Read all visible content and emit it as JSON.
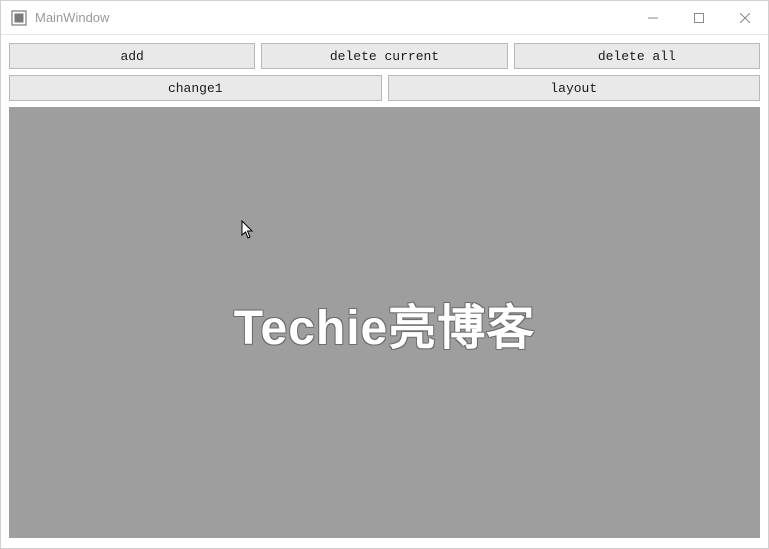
{
  "window": {
    "title": "MainWindow"
  },
  "toolbar": {
    "row1": {
      "add_label": "add",
      "delete_current_label": "delete current",
      "delete_all_label": "delete all"
    },
    "row2": {
      "change1_label": "change1",
      "layout_label": "layout"
    }
  },
  "canvas": {
    "watermark_text": "Techie亮博客"
  }
}
